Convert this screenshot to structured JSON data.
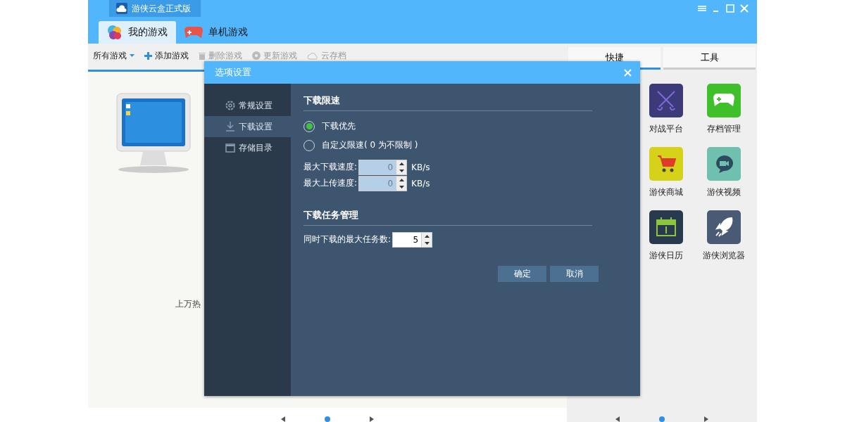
{
  "window": {
    "title": "游侠云盒正式版"
  },
  "main_tabs": [
    {
      "label": "我的游戏",
      "selected": true
    },
    {
      "label": "单机游戏",
      "selected": false
    }
  ],
  "toolbar": [
    {
      "label": "所有游戏",
      "kind": "dropdown",
      "disabled": false
    },
    {
      "label": "添加游戏",
      "kind": "add",
      "disabled": false
    },
    {
      "label": "删除游戏",
      "kind": "delete",
      "disabled": true
    },
    {
      "label": "更新游戏",
      "kind": "update",
      "disabled": true
    },
    {
      "label": "云存档",
      "kind": "cloud",
      "disabled": true
    }
  ],
  "library": {
    "caption": "上万热"
  },
  "side_panel": {
    "tabs": [
      {
        "label": "快捷",
        "selected": true
      },
      {
        "label": "工具",
        "selected": false
      }
    ],
    "shortcuts": [
      {
        "label": "对战平台",
        "kind": "swords",
        "color": "#3d3a7a"
      },
      {
        "label": "存档管理",
        "kind": "gamepad",
        "color": "#3fbf2a"
      },
      {
        "label": "游侠商城",
        "kind": "cart",
        "color": "#d6d21a"
      },
      {
        "label": "游侠视频",
        "kind": "video",
        "color": "#6fc0ae"
      },
      {
        "label": "游侠日历",
        "kind": "calendar",
        "color": "#2a3a4e"
      },
      {
        "label": "游侠浏览器",
        "kind": "rocket",
        "color": "#4a5a75"
      }
    ]
  },
  "dialog": {
    "title": "选项设置",
    "nav": [
      {
        "label": "常规设置",
        "kind": "gear",
        "selected": false
      },
      {
        "label": "下载设置",
        "kind": "download",
        "selected": true
      },
      {
        "label": "存储目录",
        "kind": "folder",
        "selected": false
      }
    ],
    "speed_section": {
      "heading": "下载限速",
      "options": [
        {
          "label": "下载优先",
          "selected": true
        },
        {
          "label": "自定义限速( 0 为不限制 )",
          "selected": false
        }
      ],
      "fields": [
        {
          "label": "最大下载速度:",
          "value": "0",
          "unit": "KB/s",
          "disabled": true
        },
        {
          "label": "最大上传速度:",
          "value": "0",
          "unit": "KB/s",
          "disabled": true
        }
      ]
    },
    "task_section": {
      "heading": "下载任务管理",
      "label": "同时下载的最大任务数:",
      "value": "5"
    },
    "buttons": [
      "确定",
      "取消"
    ]
  }
}
